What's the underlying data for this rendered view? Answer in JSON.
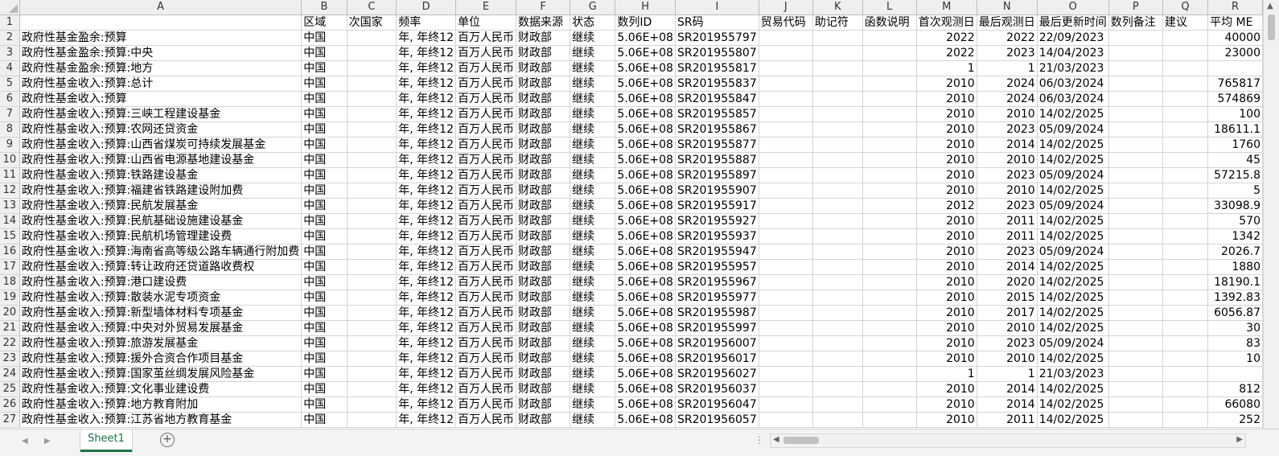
{
  "columns": [
    "A",
    "B",
    "C",
    "D",
    "E",
    "F",
    "G",
    "H",
    "I",
    "J",
    "K",
    "L",
    "M",
    "N",
    "O",
    "P",
    "Q",
    "R"
  ],
  "headers": [
    "",
    "区域",
    "次国家",
    "频率",
    "单位",
    "数据来源",
    "状态",
    "数列ID",
    "SR码",
    "贸易代码",
    "助记符",
    "函数说明",
    "首次观测日",
    "最后观测日",
    "最后更新时间",
    "数列备注",
    "建议",
    "平均 ME"
  ],
  "rows": [
    {
      "n": "2",
      "a": "政府性基金盈余:预算",
      "b": "中国",
      "d": "年, 年终12",
      "e": "百万人民币",
      "f": "财政部",
      "g": "继续",
      "h": "5.06E+08",
      "i": "SR201955797",
      "m": "2022",
      "nn": "2022",
      "o": "22/09/2023",
      "r": "40000"
    },
    {
      "n": "3",
      "a": "政府性基金盈余:预算:中央",
      "b": "中国",
      "d": "年, 年终12",
      "e": "百万人民币",
      "f": "财政部",
      "g": "继续",
      "h": "5.06E+08",
      "i": "SR201955807",
      "m": "2022",
      "nn": "2023",
      "o": "14/04/2023",
      "r": "23000"
    },
    {
      "n": "4",
      "a": "政府性基金盈余:预算:地方",
      "b": "中国",
      "d": "年, 年终12",
      "e": "百万人民币",
      "f": "财政部",
      "g": "继续",
      "h": "5.06E+08",
      "i": "SR201955817",
      "m": "1",
      "nn": "1",
      "o": "21/03/2023",
      "r": ""
    },
    {
      "n": "5",
      "a": "政府性基金收入:预算:总计",
      "b": "中国",
      "d": "年, 年终12",
      "e": "百万人民币",
      "f": "财政部",
      "g": "继续",
      "h": "5.06E+08",
      "i": "SR201955837",
      "m": "2010",
      "nn": "2024",
      "o": "06/03/2024",
      "r": "765817"
    },
    {
      "n": "6",
      "a": "政府性基金收入:预算",
      "b": "中国",
      "d": "年, 年终12",
      "e": "百万人民币",
      "f": "财政部",
      "g": "继续",
      "h": "5.06E+08",
      "i": "SR201955847",
      "m": "2010",
      "nn": "2024",
      "o": "06/03/2024",
      "r": "574869"
    },
    {
      "n": "7",
      "a": "政府性基金收入:预算:三峡工程建设基金",
      "b": "中国",
      "d": "年, 年终12",
      "e": "百万人民币",
      "f": "财政部",
      "g": "继续",
      "h": "5.06E+08",
      "i": "SR201955857",
      "m": "2010",
      "nn": "2010",
      "o": "14/02/2025",
      "r": "100"
    },
    {
      "n": "8",
      "a": "政府性基金收入:预算:农网还贷资金",
      "b": "中国",
      "d": "年, 年终12",
      "e": "百万人民币",
      "f": "财政部",
      "g": "继续",
      "h": "5.06E+08",
      "i": "SR201955867",
      "m": "2010",
      "nn": "2023",
      "o": "05/09/2024",
      "r": "18611.1"
    },
    {
      "n": "9",
      "a": "政府性基金收入:预算:山西省煤炭可持续发展基金",
      "b": "中国",
      "d": "年, 年终12",
      "e": "百万人民币",
      "f": "财政部",
      "g": "继续",
      "h": "5.06E+08",
      "i": "SR201955877",
      "m": "2010",
      "nn": "2014",
      "o": "14/02/2025",
      "r": "1760"
    },
    {
      "n": "10",
      "a": "政府性基金收入:预算:山西省电源基地建设基金",
      "b": "中国",
      "d": "年, 年终12",
      "e": "百万人民币",
      "f": "财政部",
      "g": "继续",
      "h": "5.06E+08",
      "i": "SR201955887",
      "m": "2010",
      "nn": "2010",
      "o": "14/02/2025",
      "r": "45"
    },
    {
      "n": "11",
      "a": "政府性基金收入:预算:铁路建设基金",
      "b": "中国",
      "d": "年, 年终12",
      "e": "百万人民币",
      "f": "财政部",
      "g": "继续",
      "h": "5.06E+08",
      "i": "SR201955897",
      "m": "2010",
      "nn": "2023",
      "o": "05/09/2024",
      "r": "57215.8"
    },
    {
      "n": "12",
      "a": "政府性基金收入:预算:福建省铁路建设附加费",
      "b": "中国",
      "d": "年, 年终12",
      "e": "百万人民币",
      "f": "财政部",
      "g": "继续",
      "h": "5.06E+08",
      "i": "SR201955907",
      "m": "2010",
      "nn": "2010",
      "o": "14/02/2025",
      "r": "5"
    },
    {
      "n": "13",
      "a": "政府性基金收入:预算:民航发展基金",
      "b": "中国",
      "d": "年, 年终12",
      "e": "百万人民币",
      "f": "财政部",
      "g": "继续",
      "h": "5.06E+08",
      "i": "SR201955917",
      "m": "2012",
      "nn": "2023",
      "o": "05/09/2024",
      "r": "33098.9"
    },
    {
      "n": "14",
      "a": "政府性基金收入:预算:民航基础设施建设基金",
      "b": "中国",
      "d": "年, 年终12",
      "e": "百万人民币",
      "f": "财政部",
      "g": "继续",
      "h": "5.06E+08",
      "i": "SR201955927",
      "m": "2010",
      "nn": "2011",
      "o": "14/02/2025",
      "r": "570"
    },
    {
      "n": "15",
      "a": "政府性基金收入:预算:民航机场管理建设费",
      "b": "中国",
      "d": "年, 年终12",
      "e": "百万人民币",
      "f": "财政部",
      "g": "继续",
      "h": "5.06E+08",
      "i": "SR201955937",
      "m": "2010",
      "nn": "2011",
      "o": "14/02/2025",
      "r": "1342"
    },
    {
      "n": "16",
      "a": "政府性基金收入:预算:海南省高等级公路车辆通行附加费",
      "b": "中国",
      "d": "年, 年终12",
      "e": "百万人民币",
      "f": "财政部",
      "g": "继续",
      "h": "5.06E+08",
      "i": "SR201955947",
      "m": "2010",
      "nn": "2023",
      "o": "05/09/2024",
      "r": "2026.7"
    },
    {
      "n": "17",
      "a": "政府性基金收入:预算:转让政府还贷道路收费权",
      "b": "中国",
      "d": "年, 年终12",
      "e": "百万人民币",
      "f": "财政部",
      "g": "继续",
      "h": "5.06E+08",
      "i": "SR201955957",
      "m": "2010",
      "nn": "2014",
      "o": "14/02/2025",
      "r": "1880"
    },
    {
      "n": "18",
      "a": "政府性基金收入:预算:港口建设费",
      "b": "中国",
      "d": "年, 年终12",
      "e": "百万人民币",
      "f": "财政部",
      "g": "继续",
      "h": "5.06E+08",
      "i": "SR201955967",
      "m": "2010",
      "nn": "2020",
      "o": "14/02/2025",
      "r": "18190.1"
    },
    {
      "n": "19",
      "a": "政府性基金收入:预算:散装水泥专项资金",
      "b": "中国",
      "d": "年, 年终12",
      "e": "百万人民币",
      "f": "财政部",
      "g": "继续",
      "h": "5.06E+08",
      "i": "SR201955977",
      "m": "2010",
      "nn": "2015",
      "o": "14/02/2025",
      "r": "1392.83"
    },
    {
      "n": "20",
      "a": "政府性基金收入:预算:新型墙体材料专项基金",
      "b": "中国",
      "d": "年, 年终12",
      "e": "百万人民币",
      "f": "财政部",
      "g": "继续",
      "h": "5.06E+08",
      "i": "SR201955987",
      "m": "2010",
      "nn": "2017",
      "o": "14/02/2025",
      "r": "6056.87"
    },
    {
      "n": "21",
      "a": "政府性基金收入:预算:中央对外贸易发展基金",
      "b": "中国",
      "d": "年, 年终12",
      "e": "百万人民币",
      "f": "财政部",
      "g": "继续",
      "h": "5.06E+08",
      "i": "SR201955997",
      "m": "2010",
      "nn": "2010",
      "o": "14/02/2025",
      "r": "30"
    },
    {
      "n": "22",
      "a": "政府性基金收入:预算:旅游发展基金",
      "b": "中国",
      "d": "年, 年终12",
      "e": "百万人民币",
      "f": "财政部",
      "g": "继续",
      "h": "5.06E+08",
      "i": "SR201956007",
      "m": "2010",
      "nn": "2023",
      "o": "05/09/2024",
      "r": "83"
    },
    {
      "n": "23",
      "a": "政府性基金收入:预算:援外合资合作项目基金",
      "b": "中国",
      "d": "年, 年终12",
      "e": "百万人民币",
      "f": "财政部",
      "g": "继续",
      "h": "5.06E+08",
      "i": "SR201956017",
      "m": "2010",
      "nn": "2010",
      "o": "14/02/2025",
      "r": "10"
    },
    {
      "n": "24",
      "a": "政府性基金收入:预算:国家茧丝绸发展风险基金",
      "b": "中国",
      "d": "年, 年终12",
      "e": "百万人民币",
      "f": "财政部",
      "g": "继续",
      "h": "5.06E+08",
      "i": "SR201956027",
      "m": "1",
      "nn": "1",
      "o": "21/03/2023",
      "r": ""
    },
    {
      "n": "25",
      "a": "政府性基金收入:预算:文化事业建设费",
      "b": "中国",
      "d": "年, 年终12",
      "e": "百万人民币",
      "f": "财政部",
      "g": "继续",
      "h": "5.06E+08",
      "i": "SR201956037",
      "m": "2010",
      "nn": "2014",
      "o": "14/02/2025",
      "r": "812"
    },
    {
      "n": "26",
      "a": "政府性基金收入:预算:地方教育附加",
      "b": "中国",
      "d": "年, 年终12",
      "e": "百万人民币",
      "f": "财政部",
      "g": "继续",
      "h": "5.06E+08",
      "i": "SR201956047",
      "m": "2010",
      "nn": "2014",
      "o": "14/02/2025",
      "r": "66080"
    },
    {
      "n": "27",
      "a": "政府性基金收入:预算:江苏省地方教育基金",
      "b": "中国",
      "d": "年, 年终12",
      "e": "百万人民币",
      "f": "财政部",
      "g": "继续",
      "h": "5.06E+08",
      "i": "SR201956057",
      "m": "2010",
      "nn": "2011",
      "o": "14/02/2025",
      "r": "252"
    }
  ],
  "sheet_tab": "Sheet1",
  "add_sheet_symbol": "+",
  "icons": [
    "corner-triangle-icon",
    "prev-sheet-icon",
    "next-sheet-icon",
    "add-sheet-icon",
    "scroll-left-icon",
    "scroll-right-icon",
    "scroll-up-icon"
  ]
}
